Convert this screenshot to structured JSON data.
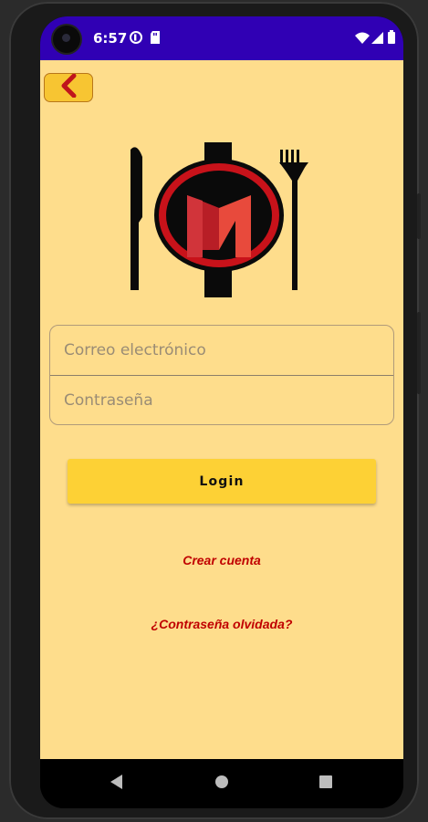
{
  "status_bar": {
    "time": "6:57"
  },
  "login": {
    "email_placeholder": "Correo electrónico",
    "password_placeholder": "Contraseña",
    "login_label": "Login",
    "create_account_label": "Crear cuenta",
    "forgot_password_label": "¿Contraseña olvidada?"
  },
  "icons": {
    "back": "chevron-left-icon",
    "logo": "restaurant-m-logo",
    "nav_back": "triangle-back-icon",
    "nav_home": "circle-home-icon",
    "nav_recents": "square-recents-icon"
  },
  "colors": {
    "background": "#fedd8c",
    "status_bar": "#3000b4",
    "accent_button": "#fdd135",
    "link": "#c00000",
    "back_button": "#f7c532",
    "back_chevron": "#c0141c"
  }
}
